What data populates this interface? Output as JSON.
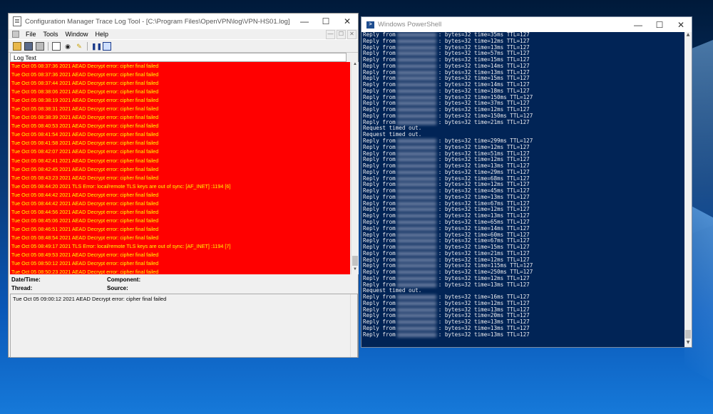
{
  "cmtrace": {
    "title": "Configuration Manager Trace Log Tool - [C:\\Program Files\\OpenVPN\\log\\VPN-HS01.log]",
    "menu": [
      "File",
      "Tools",
      "Window",
      "Help"
    ],
    "toolbar_icons": [
      "open-icon",
      "save-icon",
      "print-icon",
      "copy-icon",
      "find-icon",
      "highlight-icon",
      "pause-icon",
      "view-icon"
    ],
    "log_header": "Log Text",
    "log_lines": [
      "Tue Oct 05 08:37:36 2021 AEAD Decrypt error: cipher final failed",
      "Tue Oct 05 08:37:36 2021 AEAD Decrypt error: cipher final failed",
      "Tue Oct 05 08:37:44 2021 AEAD Decrypt error: cipher final failed",
      "Tue Oct 05 08:38:06 2021 AEAD Decrypt error: cipher final failed",
      "Tue Oct 05 08:38:19 2021 AEAD Decrypt error: cipher final failed",
      "Tue Oct 05 08:38:31 2021 AEAD Decrypt error: cipher final failed",
      "Tue Oct 05 08:38:39 2021 AEAD Decrypt error: cipher final failed",
      "Tue Oct 05 08:40:53 2021 AEAD Decrypt error: cipher final failed",
      "Tue Oct 05 08:41:54 2021 AEAD Decrypt error: cipher final failed",
      "Tue Oct 05 08:41:58 2021 AEAD Decrypt error: cipher final failed",
      "Tue Oct 05 08:42:07 2021 AEAD Decrypt error: cipher final failed",
      "Tue Oct 05 08:42:41 2021 AEAD Decrypt error: cipher final failed",
      "Tue Oct 05 08:42:45 2021 AEAD Decrypt error: cipher final failed",
      "Tue Oct 05 08:43:23 2021 AEAD Decrypt error: cipher final failed",
      "Tue Oct 05 08:44:20 2021 TLS Error: local/remote TLS keys are out of sync: [AF_INET]            :1194 [6]",
      "Tue Oct 05 08:44:42 2021 AEAD Decrypt error: cipher final failed",
      "Tue Oct 05 08:44:42 2021 AEAD Decrypt error: cipher final failed",
      "Tue Oct 05 08:44:56 2021 AEAD Decrypt error: cipher final failed",
      "Tue Oct 05 08:45:06 2021 AEAD Decrypt error: cipher final failed",
      "Tue Oct 05 08:46:51 2021 AEAD Decrypt error: cipher final failed",
      "Tue Oct 05 08:48:54 2021 AEAD Decrypt error: cipher final failed",
      "Tue Oct 05 08:49:17 2021 TLS Error: local/remote TLS keys are out of sync: [AF_INET]            :1194 [7]",
      "Tue Oct 05 08:49:53 2021 AEAD Decrypt error: cipher final failed",
      "Tue Oct 05 08:50:12 2021 AEAD Decrypt error: cipher final failed",
      "Tue Oct 05 08:50:23 2021 AEAD Decrypt error: cipher final failed"
    ],
    "details": {
      "date_label": "Date/Time:",
      "component_label": "Component:",
      "thread_label": "Thread:",
      "source_label": "Source:"
    },
    "message": "Tue Oct 05 09:00:12 2021 AEAD Decrypt error: cipher final failed",
    "colors": {
      "error_bg": "#ff0000",
      "error_text": "#ffff00"
    }
  },
  "powershell": {
    "title": "Windows PowerShell",
    "lines": [
      {
        "t": "reply",
        "rest": ": bytes=32 time=35ms TTL=127"
      },
      {
        "t": "reply",
        "rest": ": bytes=32 time=12ms TTL=127"
      },
      {
        "t": "reply",
        "rest": ": bytes=32 time=13ms TTL=127"
      },
      {
        "t": "reply",
        "rest": ": bytes=32 time=57ms TTL=127"
      },
      {
        "t": "reply",
        "rest": ": bytes=32 time=15ms TTL=127"
      },
      {
        "t": "reply",
        "rest": ": bytes=32 time=14ms TTL=127"
      },
      {
        "t": "reply",
        "rest": ": bytes=32 time=13ms TTL=127"
      },
      {
        "t": "reply",
        "rest": ": bytes=32 time=15ms TTL=127"
      },
      {
        "t": "reply",
        "rest": ": bytes=32 time=14ms TTL=127"
      },
      {
        "t": "reply",
        "rest": ": bytes=32 time=18ms TTL=127"
      },
      {
        "t": "reply",
        "rest": ": bytes=32 time=150ms TTL=127"
      },
      {
        "t": "reply",
        "rest": ": bytes=32 time=37ms TTL=127"
      },
      {
        "t": "reply",
        "rest": ": bytes=32 time=12ms TTL=127"
      },
      {
        "t": "reply",
        "rest": ": bytes=32 time=150ms TTL=127"
      },
      {
        "t": "reply",
        "rest": ": bytes=32 time=21ms TTL=127"
      },
      {
        "t": "plain",
        "text": "Request timed out."
      },
      {
        "t": "plain",
        "text": "Request timed out."
      },
      {
        "t": "reply",
        "rest": ": bytes=32 time=299ms TTL=127"
      },
      {
        "t": "reply",
        "rest": ": bytes=32 time=12ms TTL=127"
      },
      {
        "t": "reply",
        "rest": ": bytes=32 time=51ms TTL=127"
      },
      {
        "t": "reply",
        "rest": ": bytes=32 time=12ms TTL=127"
      },
      {
        "t": "reply",
        "rest": ": bytes=32 time=13ms TTL=127"
      },
      {
        "t": "reply",
        "rest": ": bytes=32 time=29ms TTL=127"
      },
      {
        "t": "reply",
        "rest": ": bytes=32 time=68ms TTL=127"
      },
      {
        "t": "reply",
        "rest": ": bytes=32 time=12ms TTL=127"
      },
      {
        "t": "reply",
        "rest": ": bytes=32 time=45ms TTL=127"
      },
      {
        "t": "reply",
        "rest": ": bytes=32 time=13ms TTL=127"
      },
      {
        "t": "reply",
        "rest": ": bytes=32 time=67ms TTL=127"
      },
      {
        "t": "reply",
        "rest": ": bytes=32 time=12ms TTL=127"
      },
      {
        "t": "reply",
        "rest": ": bytes=32 time=13ms TTL=127"
      },
      {
        "t": "reply",
        "rest": ": bytes=32 time=65ms TTL=127"
      },
      {
        "t": "reply",
        "rest": ": bytes=32 time=14ms TTL=127"
      },
      {
        "t": "reply",
        "rest": ": bytes=32 time=60ms TTL=127"
      },
      {
        "t": "reply",
        "rest": ": bytes=32 time=67ms TTL=127"
      },
      {
        "t": "reply",
        "rest": ": bytes=32 time=15ms TTL=127"
      },
      {
        "t": "reply",
        "rest": ": bytes=32 time=21ms TTL=127"
      },
      {
        "t": "reply",
        "rest": ": bytes=32 time=12ms TTL=127"
      },
      {
        "t": "reply",
        "rest": ": bytes=32 time=115ms TTL=127"
      },
      {
        "t": "reply",
        "rest": ": bytes=32 time=250ms TTL=127"
      },
      {
        "t": "reply",
        "rest": ": bytes=32 time=12ms TTL=127"
      },
      {
        "t": "reply",
        "rest": ": bytes=32 time=13ms TTL=127"
      },
      {
        "t": "plain",
        "text": "Request timed out."
      },
      {
        "t": "reply",
        "rest": ": bytes=32 time=16ms TTL=127"
      },
      {
        "t": "reply",
        "rest": ": bytes=32 time=12ms TTL=127"
      },
      {
        "t": "reply",
        "rest": ": bytes=32 time=13ms TTL=127"
      },
      {
        "t": "reply",
        "rest": ": bytes=32 time=20ms TTL=127"
      },
      {
        "t": "reply",
        "rest": ": bytes=32 time=13ms TTL=127"
      },
      {
        "t": "reply",
        "rest": ": bytes=32 time=13ms TTL=127"
      },
      {
        "t": "reply",
        "rest": ": bytes=32 time=13ms TTL=127"
      }
    ],
    "reply_prefix": "Reply from",
    "colors": {
      "bg": "#012456",
      "text": "#eeedf0"
    }
  },
  "window_controls": {
    "minimize": "—",
    "maximize": "☐",
    "close": "✕"
  }
}
